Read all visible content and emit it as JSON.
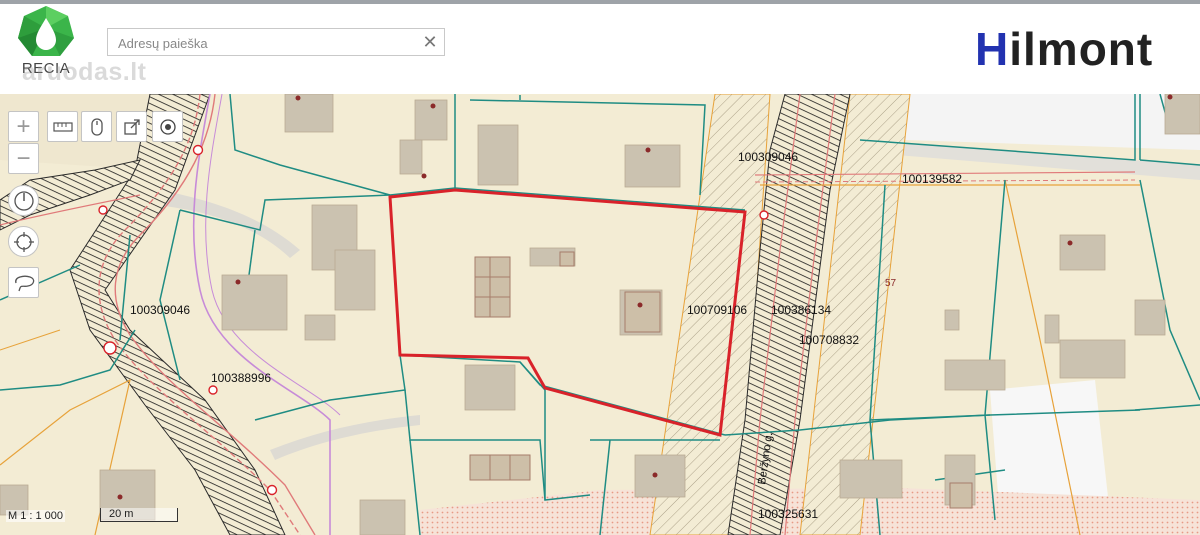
{
  "header": {
    "logo_text": "RECIA",
    "watermark": "aruodas.lt",
    "brand_first_letter": "H",
    "brand_rest": "ilmont"
  },
  "search": {
    "placeholder": "Adresų paieška",
    "clear_symbol": "✕"
  },
  "controls": {
    "zoom_in": "+",
    "zoom_out": "−",
    "icons": [
      "ruler-icon",
      "mouse-icon",
      "share-icon",
      "location-target-icon",
      "compass-icon",
      "crosshair-icon",
      "lasso-icon"
    ]
  },
  "map": {
    "parcel_ids": {
      "a": "100309046",
      "b": "100309046",
      "c": "100139582",
      "d": "100388996",
      "e": "100709106",
      "f": "100386134",
      "g": "100708832",
      "h": "100325631"
    },
    "street_label": "Beržyno g.",
    "house_numbers": [
      "57"
    ],
    "colors": {
      "parcel_fill": "#f3ecd4",
      "parcel_border": "#1f8c83",
      "highlight_border": "#d9222a",
      "building": "#cbc2b0",
      "road_line": "#e07a7a",
      "utility_line": "#e7a23a",
      "pink_line": "#c78bd8",
      "hatch": "#2a2a2a"
    }
  },
  "scale": {
    "ratio": "M 1 : 1 000",
    "bar": "20 m"
  }
}
